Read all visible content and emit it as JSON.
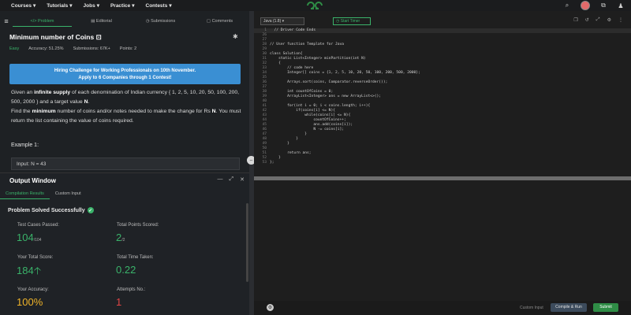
{
  "nav": {
    "items": [
      "Courses",
      "Tutorials",
      "Jobs",
      "Practice",
      "Contests"
    ]
  },
  "colors": {
    "accent": "#3ab36a",
    "banner": "#3a8fd3",
    "yellow": "#f0b429",
    "red": "#e24545"
  },
  "tabs": [
    {
      "label": "</> Problem"
    },
    {
      "label": "Editorial"
    },
    {
      "label": "Submissions"
    },
    {
      "label": "Comments"
    }
  ],
  "problem": {
    "title": "Minimum number of Coins",
    "difficulty": "Easy",
    "accuracy": "Accuracy: 51.25%",
    "submissions": "Submissions: 67K+",
    "points": "Points: 2",
    "banner_line1": "Hiring Challenge for Working Professionals on 10th November.",
    "banner_line2": "Apply to 6 Companies through 1 Contest!",
    "desc1_a": "Given an ",
    "desc1_b": "infinite supply",
    "desc1_c": " of each denomination of Indian currency { 1, 2, 5, 10, 20, 50, 100, 200, 500, 2000 } and a target value ",
    "desc1_d": "N",
    "desc1_e": ".",
    "desc2_a": "Find the ",
    "desc2_b": "minimum",
    "desc2_c": " number of coins and/or notes needed to make the change for Rs ",
    "desc2_d": "N",
    "desc2_e": ". You must return the list containing the value of coins required.",
    "example_label": "Example 1:",
    "input_label": "Input:",
    "input_value": "N = 43"
  },
  "output": {
    "title": "Output Window",
    "tab_results": "Compilation Results",
    "tab_custom": "Custom Input",
    "solved": "Problem Solved Successfully",
    "test_cases_label": "Test Cases Passed:",
    "test_cases_value": "104",
    "test_cases_total": "/104",
    "points_label": "Total Points Scored:",
    "points_value": "2",
    "points_total": "/2",
    "score_label": "Your Total Score:",
    "score_value": "184",
    "time_label": "Total Time Taken:",
    "time_value": "0.22",
    "accuracy_label": "Your Accuracy:",
    "accuracy_value": "100%",
    "attempts_label": "Attempts No.:",
    "attempts_value": "1"
  },
  "editor": {
    "language": "Java (1.8)",
    "timer": "Start Timer",
    "custom_input": "Custom Input",
    "compile": "Compile & Run",
    "submit": "Submit",
    "lines": [
      {
        "n": "1",
        "t": "  // Driver Code Ends"
      },
      {
        "n": "26",
        "t": ""
      },
      {
        "n": "27",
        "t": ""
      },
      {
        "n": "28",
        "t": "// User function Template for Java"
      },
      {
        "n": "29",
        "t": ""
      },
      {
        "n": "30",
        "t": "class Solution{"
      },
      {
        "n": "31",
        "t": "    static List<Integer> minPartition(int N)"
      },
      {
        "n": "32",
        "t": "    {"
      },
      {
        "n": "33",
        "t": "        // code here"
      },
      {
        "n": "34",
        "t": "        Integer[] coins = {1, 2, 5, 10, 20, 50, 100, 200, 500, 2000};"
      },
      {
        "n": "35",
        "t": ""
      },
      {
        "n": "36",
        "t": "        Arrays.sort(coins, Comparator.reverseOrder());"
      },
      {
        "n": "37",
        "t": ""
      },
      {
        "n": "38",
        "t": "        int countOfCoins = 0;"
      },
      {
        "n": "39",
        "t": "        ArrayList<Integer> ans = new ArrayList<>();"
      },
      {
        "n": "40",
        "t": ""
      },
      {
        "n": "41",
        "t": "        for(int i = 0; i < coins.length; i++){"
      },
      {
        "n": "42",
        "t": "            if(coins[i] <= N){"
      },
      {
        "n": "43",
        "t": "                while(coins[i] <= N){"
      },
      {
        "n": "44",
        "t": "                    countOfCoins++;"
      },
      {
        "n": "45",
        "t": "                    ans.add(coins[i]);"
      },
      {
        "n": "46",
        "t": "                    N -= coins[i];"
      },
      {
        "n": "47",
        "t": "                }"
      },
      {
        "n": "48",
        "t": "            }"
      },
      {
        "n": "49",
        "t": "        }"
      },
      {
        "n": "50",
        "t": ""
      },
      {
        "n": "51",
        "t": "        return ans;"
      },
      {
        "n": "52",
        "t": "    }"
      },
      {
        "n": "53",
        "t": "};"
      }
    ]
  }
}
